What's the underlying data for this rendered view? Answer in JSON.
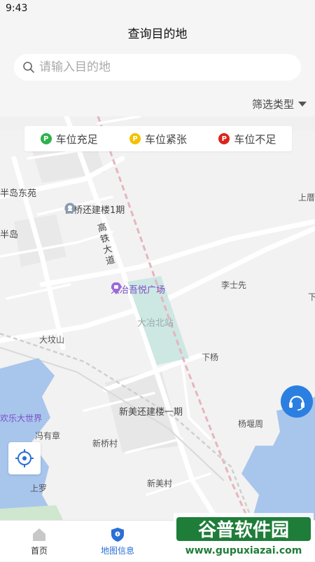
{
  "status": {
    "time": "9:43"
  },
  "header": {
    "title": "查询目的地"
  },
  "search": {
    "placeholder": "请输入目的地"
  },
  "filter": {
    "label": "筛选类型"
  },
  "legend": [
    {
      "label": "车位充足",
      "color": "#2db34a",
      "glyph": "P"
    },
    {
      "label": "车位紧张",
      "color": "#f2c200",
      "glyph": "P"
    },
    {
      "label": "车位不足",
      "color": "#d9251c",
      "glyph": "P"
    }
  ],
  "map": {
    "labels": {
      "bandao_dongyuan": "半岛东苑",
      "bandao": "半岛",
      "wuqiao": "伍桥还建楼1期",
      "gaotie": "高铁大道",
      "wuyue": "大冶吾悦广场",
      "station": "大冶北站",
      "lishixian": "李士先",
      "dafenshan": "大坟山",
      "xiayang": "下杨",
      "xinmei_build": "新美还建楼一期",
      "yangyanzhou": "杨堰周",
      "huanle": "欢乐大世界",
      "fengyouzhang": "冯有章",
      "xinqiaocun": "新桥村",
      "xinmeicun": "新美村",
      "shangluo": "上罗",
      "shangmiao": "上厝",
      "xia": "下"
    },
    "colors": {
      "water": "#a8c5ec",
      "station": "#cde7e3",
      "rail": "#e6b5bd"
    }
  },
  "controls": {
    "locate_icon": "locate-crosshair-icon",
    "service_icon": "headset-icon"
  },
  "tabs": [
    {
      "label": "首页",
      "icon": "home-icon",
      "active": false
    },
    {
      "label": "地图信息",
      "icon": "map-pin-icon",
      "active": true
    }
  ],
  "watermark": {
    "text": "谷普软件园",
    "url": "www.gupuxiazai.com"
  }
}
